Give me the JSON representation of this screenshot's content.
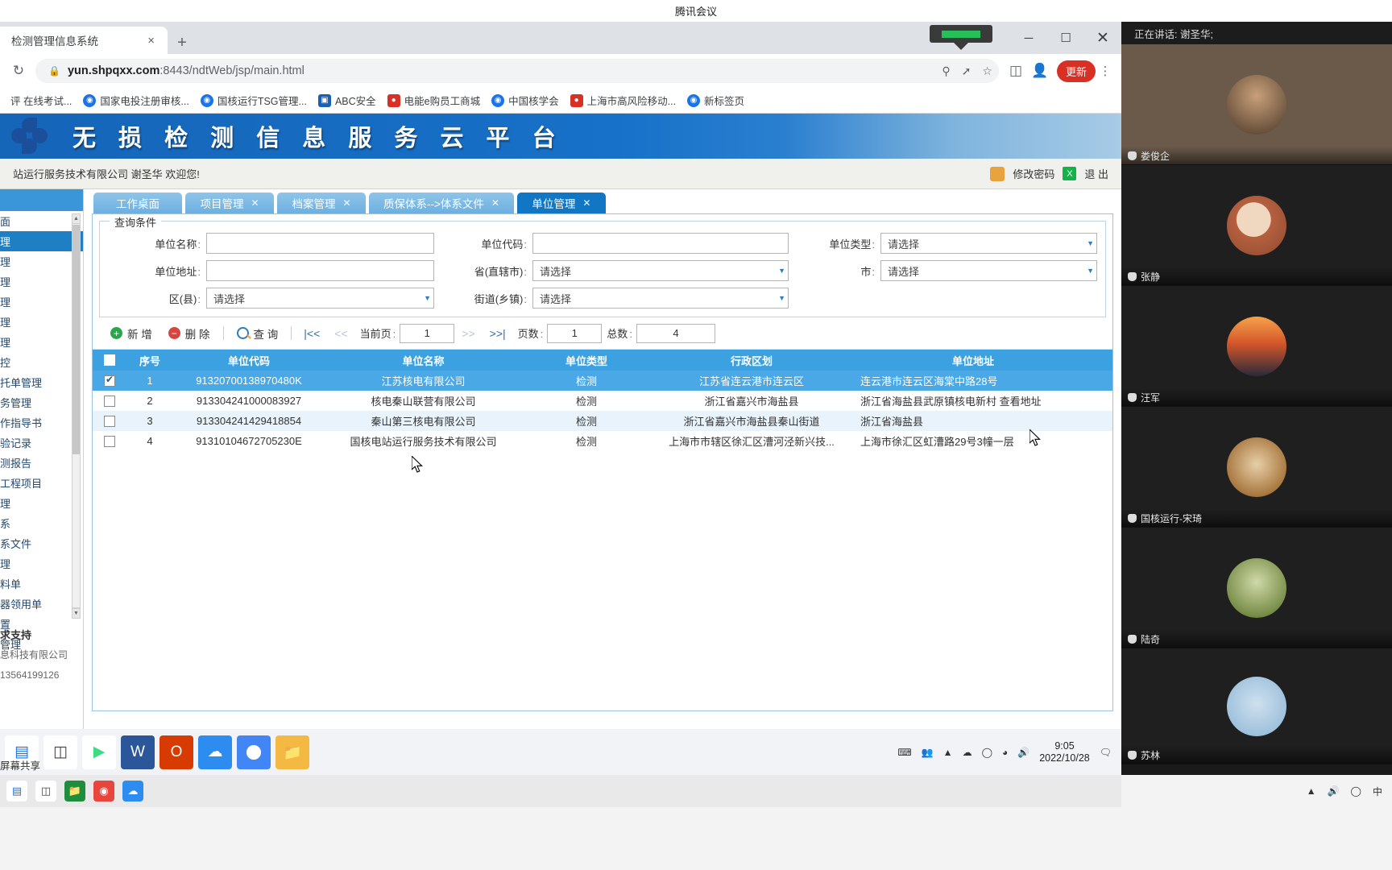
{
  "meeting": {
    "app_title": "腾讯会议",
    "speaking_label": "正在讲话: 谢圣华;",
    "participants": [
      {
        "name": "娄俊企"
      },
      {
        "name": "张静"
      },
      {
        "name": "汪军"
      },
      {
        "name": "国核运行-宋琦"
      },
      {
        "name": "陆奇"
      },
      {
        "name": "苏林"
      }
    ]
  },
  "browser": {
    "tab_title": "检测管理信息系统",
    "tab_close": "×",
    "new_tab": "+",
    "url_host": "yun.shpqxx.com",
    "url_path": ":8443/ndtWeb/jsp/main.html",
    "update_label": "更新",
    "window": {
      "minimize": "─",
      "maximize": "☐",
      "close": "✕"
    },
    "bookmarks": [
      {
        "label": "评 在线考试...",
        "icon": "globe-icon"
      },
      {
        "label": "国家电投注册审核...",
        "icon": "globe-icon"
      },
      {
        "label": "国核运行TSG管理...",
        "icon": "globe-icon"
      },
      {
        "label": "ABC安全",
        "icon": "shield-icon"
      },
      {
        "label": "电能e购员工商城",
        "icon": "red-icon"
      },
      {
        "label": "中国核学会",
        "icon": "globe-icon"
      },
      {
        "label": "上海市高风险移动...",
        "icon": "red-icon"
      },
      {
        "label": "新标签页",
        "icon": "globe-icon"
      }
    ]
  },
  "site": {
    "banner_title": "无 损 检 测 信 息 服 务 云 平 台",
    "welcome_text": "站运行服务技术有限公司 谢圣华 欢迎您!",
    "change_password": "修改密码",
    "logout": "退 出",
    "qq_icon_label": "X"
  },
  "sidebar": {
    "items": [
      {
        "label": "面"
      },
      {
        "label": "理",
        "active": true
      },
      {
        "label": "理"
      },
      {
        "label": "理"
      },
      {
        "label": "理"
      },
      {
        "label": "理"
      },
      {
        "label": "理"
      },
      {
        "label": "控"
      },
      {
        "label": "托单管理"
      },
      {
        "label": "务管理"
      },
      {
        "label": "作指导书"
      },
      {
        "label": "验记录"
      },
      {
        "label": "测报告"
      },
      {
        "label": "工程项目"
      },
      {
        "label": "理"
      },
      {
        "label": "系"
      },
      {
        "label": "系文件"
      },
      {
        "label": "理"
      },
      {
        "label": "料单"
      },
      {
        "label": "器领用单"
      },
      {
        "label": "置"
      },
      {
        "label": "管理"
      }
    ],
    "support_title": "求支持",
    "support_company": "息科技有限公司",
    "support_phone": "13564199126"
  },
  "tabs": [
    {
      "label": "工作桌面",
      "closable": false,
      "active": false
    },
    {
      "label": "项目管理",
      "closable": true,
      "active": false
    },
    {
      "label": "档案管理",
      "closable": true,
      "active": false
    },
    {
      "label": "质保体系-->体系文件",
      "closable": true,
      "active": false
    },
    {
      "label": "单位管理",
      "closable": true,
      "active": true
    }
  ],
  "query_form": {
    "legend": "查询条件",
    "fields": {
      "unit_name_label": "单位名称",
      "unit_name_value": "",
      "unit_code_label": "单位代码",
      "unit_code_value": "",
      "unit_type_label": "单位类型",
      "unit_type_value": "请选择",
      "unit_addr_label": "单位地址",
      "unit_addr_value": "",
      "province_label": "省(直辖市)",
      "province_value": "请选择",
      "city_label": "市",
      "city_value": "请选择",
      "district_label": "区(县)",
      "district_value": "请选择",
      "street_label": "街道(乡镇)",
      "street_value": "请选择"
    }
  },
  "toolbar": {
    "add_label": "新 增",
    "delete_label": "删 除",
    "query_label": "查 询",
    "first_page": "|<<",
    "prev_page": "<<",
    "next_page": ">>",
    "last_page": ">>|",
    "current_page_label": "当前页",
    "current_page_value": "1",
    "page_count_label": "页数",
    "page_count_value": "1",
    "total_label": "总数",
    "total_value": "4"
  },
  "table": {
    "columns": [
      "序号",
      "单位代码",
      "单位名称",
      "单位类型",
      "行政区划",
      "单位地址"
    ],
    "rows": [
      {
        "checked": true,
        "index": "1",
        "code": "91320700138970480K",
        "name": "江苏核电有限公司",
        "type": "检测",
        "region": "江苏省连云港市连云区",
        "address": "连云港市连云区海棠中路28号"
      },
      {
        "checked": false,
        "index": "2",
        "code": "913304241000083927",
        "name": "核电秦山联营有限公司",
        "type": "检测",
        "region": "浙江省嘉兴市海盐县",
        "address": "浙江省海盐县武原镇核电新村 查看地址"
      },
      {
        "checked": false,
        "index": "3",
        "code": "913304241429418854",
        "name": "秦山第三核电有限公司",
        "type": "检测",
        "region": "浙江省嘉兴市海盐县秦山街道",
        "address": "浙江省海盐县"
      },
      {
        "checked": false,
        "index": "4",
        "code": "91310104672705230E",
        "name": "国核电站运行服务技术有限公司",
        "type": "检测",
        "region": "上海市市辖区徐汇区漕河泾新兴技...",
        "address": "上海市徐汇区虹漕路29号3幢一层"
      }
    ]
  },
  "taskbar": {
    "clock_time": "9:05",
    "clock_date": "2022/10/28",
    "ime_label": "中",
    "share_label": "屏幕共享"
  }
}
